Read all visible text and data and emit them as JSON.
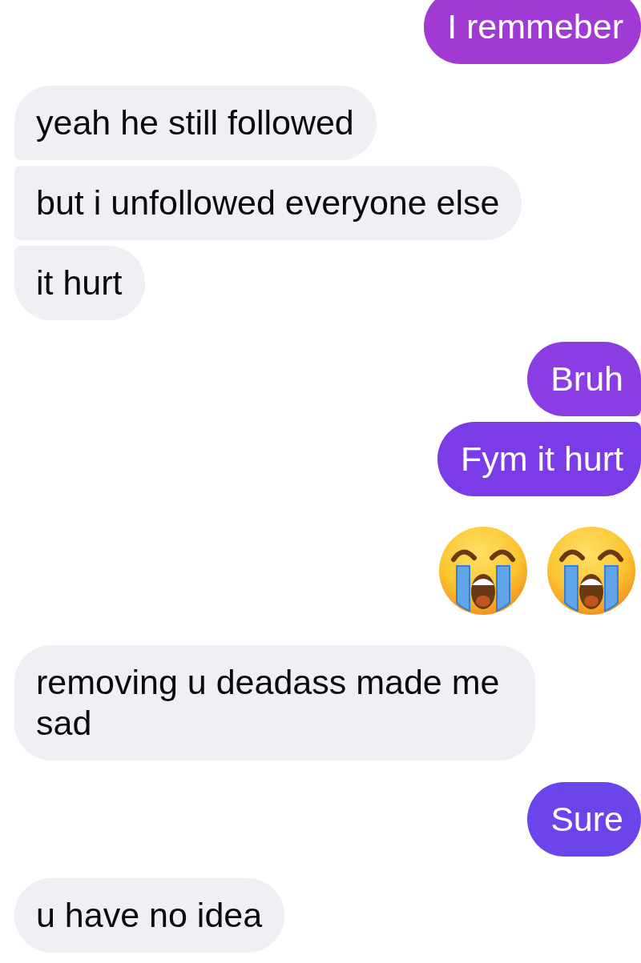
{
  "messages": [
    {
      "kind": "text",
      "outgoing": true,
      "text": "I remmeber",
      "color": "#a03ad3"
    },
    {
      "kind": "text",
      "outgoing": false,
      "text": "yeah he still followed",
      "color": "#efeff4"
    },
    {
      "kind": "text",
      "outgoing": false,
      "text": "but i unfollowed everyone else",
      "color": "#efeff4"
    },
    {
      "kind": "text",
      "outgoing": false,
      "text": "it hurt",
      "color": "#efeff4"
    },
    {
      "kind": "text",
      "outgoing": true,
      "text": "Bruh",
      "color": "#8a3de2"
    },
    {
      "kind": "text",
      "outgoing": true,
      "text": "Fym it hurt",
      "color": "#7b3ce8"
    },
    {
      "kind": "emoji",
      "outgoing": true,
      "emojis": [
        {
          "kind": "crying"
        },
        {
          "kind": "crying"
        }
      ]
    },
    {
      "kind": "text",
      "outgoing": false,
      "text": "removing u deadass made me sad",
      "color": "#efeff4"
    },
    {
      "kind": "text",
      "outgoing": true,
      "text": "Sure",
      "color": "#6b44ec"
    },
    {
      "kind": "text",
      "outgoing": false,
      "text": "u have no idea",
      "color": "#efeff4"
    }
  ]
}
